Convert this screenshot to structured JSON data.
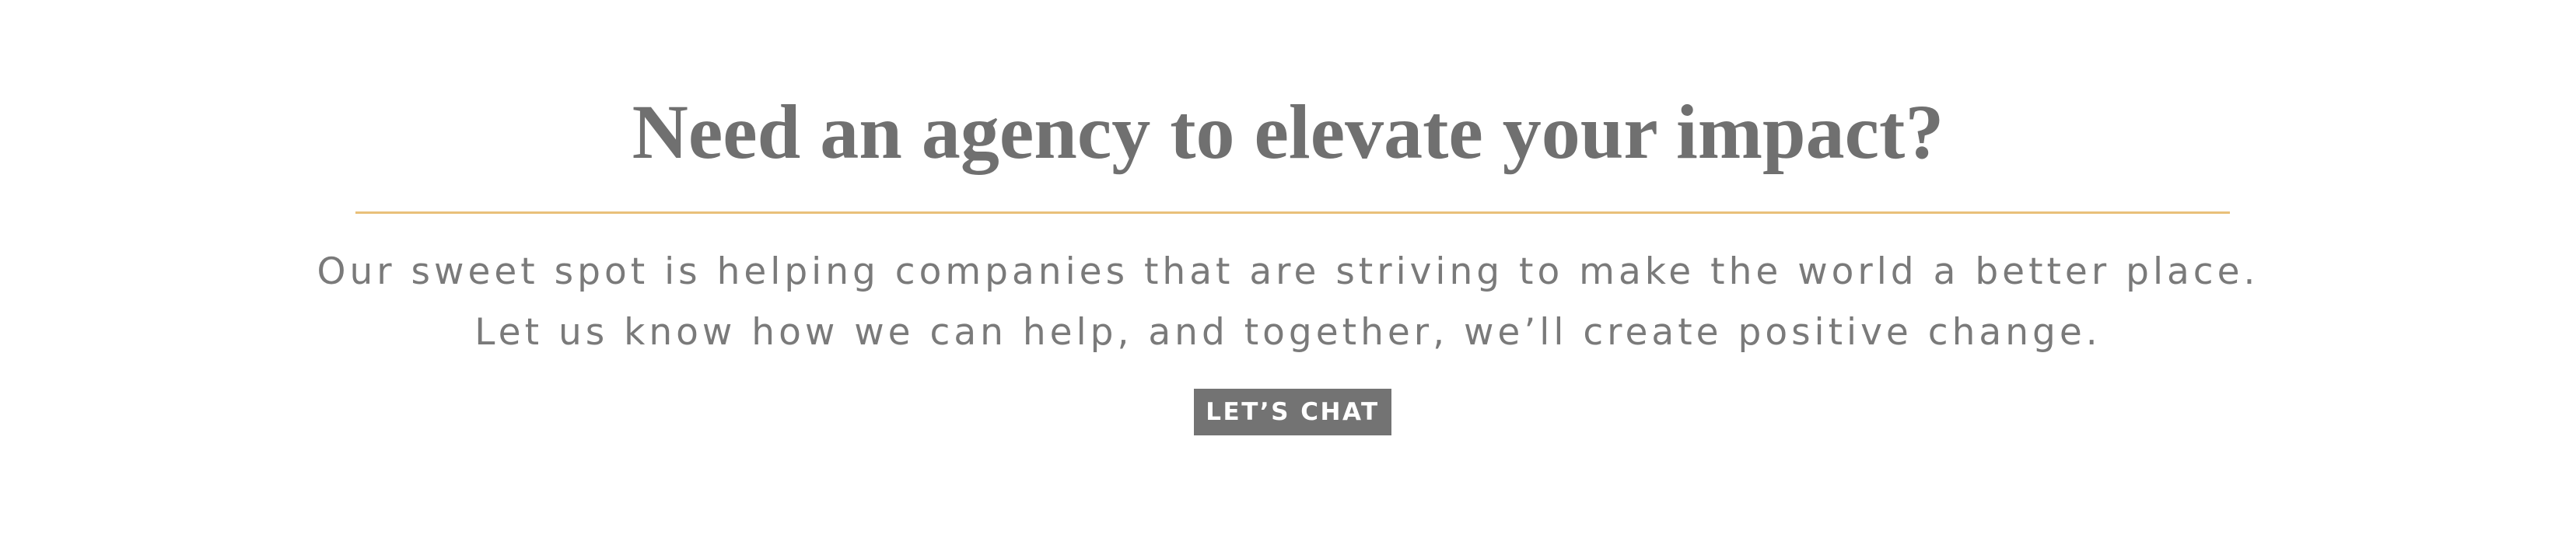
{
  "cta": {
    "heading": "Need an agency to elevate your impact?",
    "body_line_1": "Our sweet spot is helping companies that are striving to make the world a better place.",
    "body_line_2": "Let us know how we can help, and together, we’ll create positive change.",
    "button_label": "LET’S CHAT"
  },
  "colors": {
    "text": "#707070",
    "divider": "#e9c07a",
    "button_background": "#737373",
    "button_text": "#ffffff",
    "background": "#ffffff"
  }
}
